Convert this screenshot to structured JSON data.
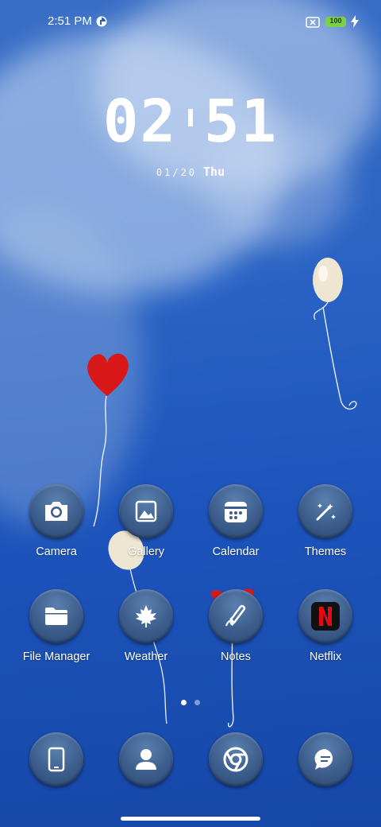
{
  "status_bar": {
    "time": "2:51 PM",
    "battery_level": "100"
  },
  "clock": {
    "hours": "02",
    "minutes": "51",
    "date": "01/20",
    "weekday": "Thu"
  },
  "apps": [
    {
      "name": "camera",
      "label": "Camera",
      "icon": "camera-icon"
    },
    {
      "name": "gallery",
      "label": "Gallery",
      "icon": "image-icon"
    },
    {
      "name": "calendar",
      "label": "Calendar",
      "icon": "calendar-icon"
    },
    {
      "name": "themes",
      "label": "Themes",
      "icon": "magic-wand-icon"
    },
    {
      "name": "file-manager",
      "label": "File Manager",
      "icon": "folder-icon"
    },
    {
      "name": "weather",
      "label": "Weather",
      "icon": "maple-leaf-icon"
    },
    {
      "name": "notes",
      "label": "Notes",
      "icon": "pen-icon"
    },
    {
      "name": "netflix",
      "label": "Netflix",
      "icon": "netflix-icon"
    }
  ],
  "dock": [
    {
      "name": "phone",
      "icon": "phone-icon"
    },
    {
      "name": "contacts",
      "icon": "person-icon"
    },
    {
      "name": "chrome",
      "icon": "chrome-icon"
    },
    {
      "name": "messages",
      "icon": "chat-icon"
    }
  ],
  "page_indicator": {
    "pages": 2,
    "current": 1
  },
  "colors": {
    "battery": "#7ad148",
    "netflix_red": "#e50914",
    "balloon_red": "#d81818"
  }
}
